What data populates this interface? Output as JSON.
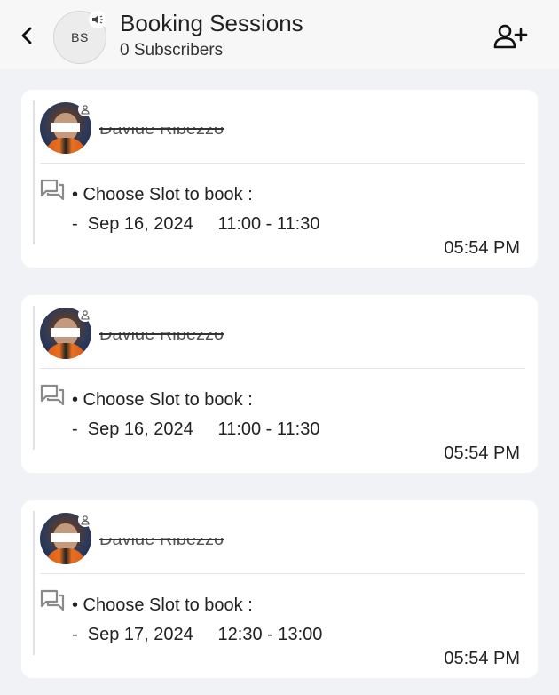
{
  "header": {
    "back_icon": "chevron-left-icon",
    "avatar_initials": "BS",
    "avatar_badge_icon": "megaphone-icon",
    "title": "Booking Sessions",
    "subtitle": "0 Subscribers",
    "add_subscriber_icon": "person-add-icon"
  },
  "messages": [
    {
      "author": "Davide Ribezzo",
      "line1": "• Choose Slot to book :",
      "line2": "-  Sep 16, 2024     11:00 - 11:30",
      "time": "05:54 PM"
    },
    {
      "author": "Davide Ribezzo",
      "line1": "• Choose Slot to book :",
      "line2": "-  Sep 16, 2024     11:00 - 11:30",
      "time": "05:54 PM"
    },
    {
      "author": "Davide Ribezzo",
      "line1": "• Choose Slot to book :",
      "line2": "-  Sep 17, 2024     12:30 - 13:00",
      "time": "05:54 PM"
    }
  ],
  "colors": {
    "page_background": "#f1f2f6",
    "card_background": "#ffffff",
    "header_background": "#f7f7f7",
    "text_primary": "#222222",
    "icon_gray": "#7a7a7a"
  }
}
